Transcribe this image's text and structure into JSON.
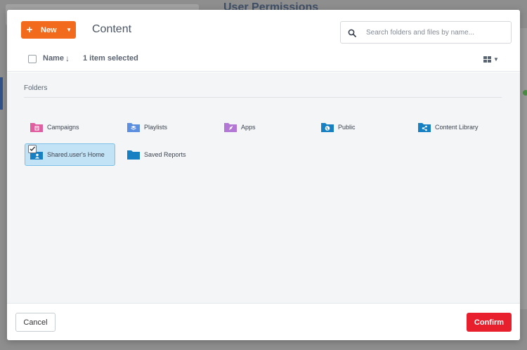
{
  "background": {
    "page_title": "User Permissions"
  },
  "header": {
    "new_label": "New",
    "title": "Content",
    "search_placeholder": "Search folders and files by name..."
  },
  "toolbar": {
    "sort_label": "Name",
    "selected_count": "1 item selected"
  },
  "section": {
    "label": "Folders"
  },
  "folders": [
    {
      "label": "Campaigns",
      "color": "#e05fa0",
      "icon": "campaigns-icon"
    },
    {
      "label": "Playlists",
      "color": "#5d8fe0",
      "icon": "playlists-icon"
    },
    {
      "label": "Apps",
      "color": "#b377d6",
      "icon": "apps-icon"
    },
    {
      "label": "Public",
      "color": "#1780c2",
      "icon": "globe-icon"
    },
    {
      "label": "Content Library",
      "color": "#1780c2",
      "icon": "share-icon"
    },
    {
      "label": "Shared.user's Home",
      "color": "#1780c2",
      "icon": "user-icon",
      "selected": true
    },
    {
      "label": "Saved Reports",
      "color": "#1780c2",
      "icon": "folder-icon"
    }
  ],
  "footer": {
    "cancel_label": "Cancel",
    "confirm_label": "Confirm"
  },
  "colors": {
    "accent_orange": "#f26b1d",
    "confirm_red": "#e8202e",
    "selection_blue": "#c2e3f6"
  }
}
